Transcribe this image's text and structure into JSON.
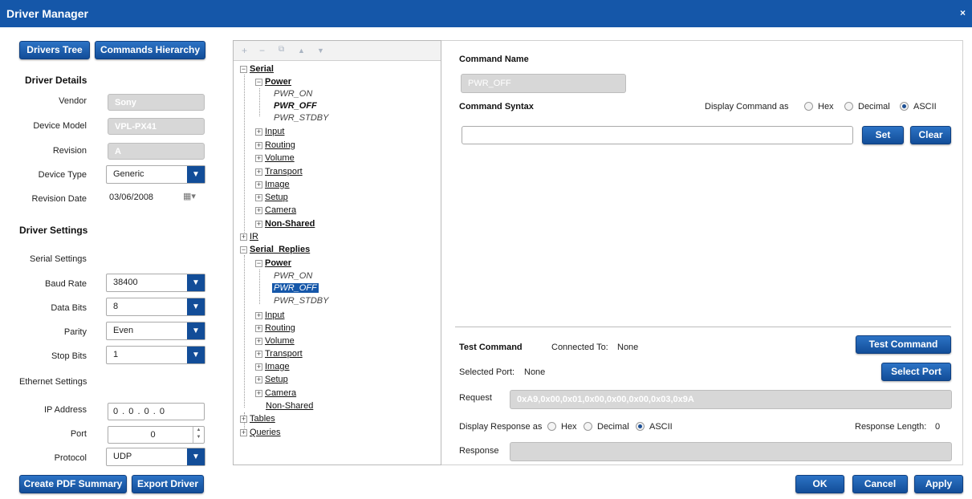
{
  "window": {
    "title": "Driver Manager",
    "close_glyph": "×"
  },
  "top_buttons": {
    "drivers_tree": "Drivers Tree",
    "commands_hierarchy": "Commands Hierarchy"
  },
  "driver_details": {
    "heading": "Driver Details",
    "vendor_label": "Vendor",
    "vendor_value": "Sony",
    "model_label": "Device Model",
    "model_value": "VPL-PX41",
    "revision_label": "Revision",
    "revision_value": "A",
    "type_label": "Device Type",
    "type_value": "Generic",
    "date_label": "Revision Date",
    "date_value": "03/06/2008"
  },
  "driver_settings": {
    "heading": "Driver Settings",
    "serial_heading": "Serial Settings",
    "baud_label": "Baud Rate",
    "baud_value": "38400",
    "databits_label": "Data Bits",
    "databits_value": "8",
    "parity_label": "Parity",
    "parity_value": "Even",
    "stopbits_label": "Stop Bits",
    "stopbits_value": "1",
    "ethernet_heading": "Ethernet Settings",
    "ip_label": "IP Address",
    "ip_value": "0 . 0 . 0 . 0",
    "port_label": "Port",
    "port_value": "0",
    "protocol_label": "Protocol",
    "protocol_value": "UDP"
  },
  "bottom_left_buttons": {
    "pdf": "Create PDF Summary",
    "export": "Export Driver"
  },
  "tree_toolbar": {
    "add": "+",
    "remove": "−",
    "copy": "⧉",
    "up": "▲",
    "down": "▼"
  },
  "tree": {
    "serial": "Serial",
    "power": "Power",
    "pwr_on": "PWR_ON",
    "pwr_off": "PWR_OFF",
    "pwr_stdby": "PWR_STDBY",
    "input": "Input",
    "routing": "Routing",
    "volume": "Volume",
    "transport": "Transport",
    "image": "Image",
    "setup": "Setup",
    "camera": "Camera",
    "non_shared": "Non-Shared",
    "ir": "IR",
    "serial_replies": "Serial_Replies",
    "r_power": "Power",
    "r_pwr_on": "PWR_ON",
    "r_pwr_off": "PWR_OFF",
    "r_pwr_stdby": "PWR_STDBY",
    "r_input": "Input",
    "r_routing": "Routing",
    "r_volume": "Volume",
    "r_transport": "Transport",
    "r_image": "Image",
    "r_setup": "Setup",
    "r_camera": "Camera",
    "r_non_shared": "Non-Shared",
    "tables": "Tables",
    "queries": "Queries"
  },
  "command": {
    "name_label": "Command Name",
    "name_value": "PWR_OFF",
    "syntax_label": "Command Syntax",
    "display_as_label": "Display Command as",
    "opt_hex": "Hex",
    "opt_decimal": "Decimal",
    "opt_ascii": "ASCII",
    "syntax_value": "",
    "set": "Set",
    "clear": "Clear"
  },
  "test": {
    "heading": "Test Command",
    "connected_label": "Connected To:",
    "connected_value": "None",
    "test_button": "Test Command",
    "port_label": "Selected Port:",
    "port_value": "None",
    "select_port": "Select Port",
    "request_label": "Request",
    "request_value": "0xA9,0x00,0x01,0x00,0x00,0x00,0x03,0x9A",
    "display_resp_label": "Display Response as",
    "opt_hex": "Hex",
    "opt_decimal": "Decimal",
    "opt_ascii": "ASCII",
    "resp_length_label": "Response Length:",
    "resp_length_value": "0",
    "response_label": "Response",
    "response_value": ""
  },
  "footer": {
    "ok": "OK",
    "cancel": "Cancel",
    "apply": "Apply"
  },
  "colors": {
    "accent": "#1557a9",
    "disabled_field": "#d7d7d7"
  }
}
